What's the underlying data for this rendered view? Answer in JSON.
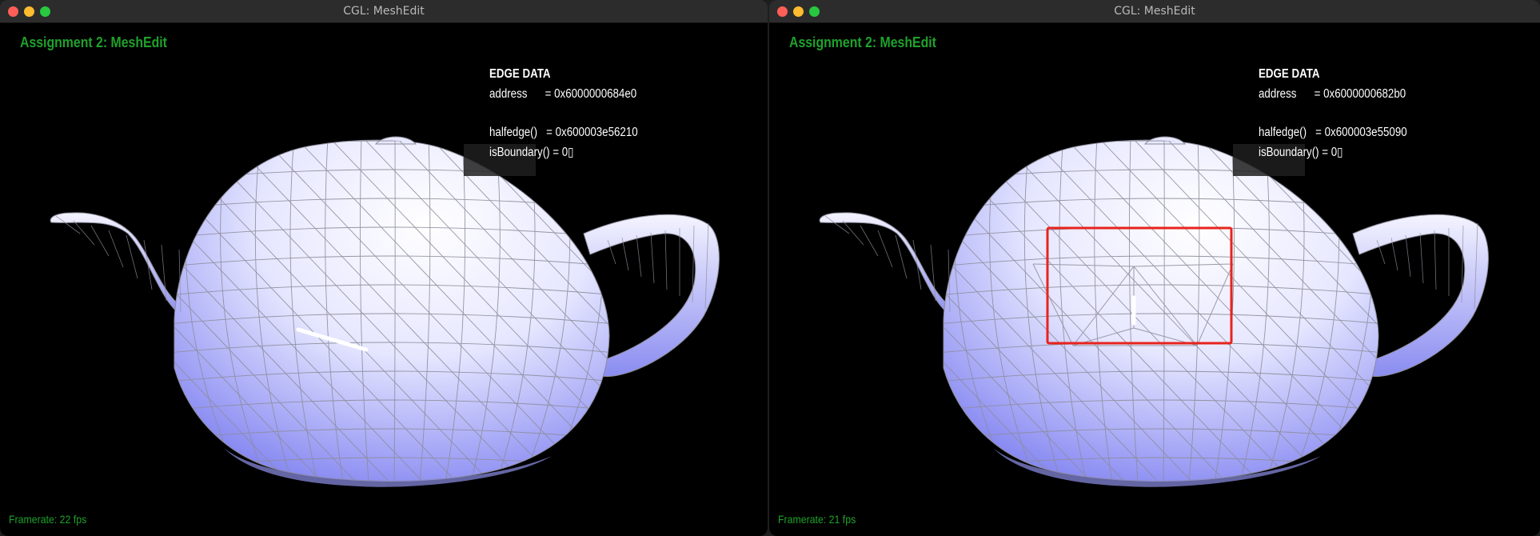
{
  "windows": [
    {
      "title": "CGL: MeshEdit",
      "assignment_label": "Assignment 2: MeshEdit",
      "edge_data": {
        "header": "EDGE DATA",
        "address_line": "address      = 0x6000000684e0",
        "halfedge_line": "halfedge()   = 0x600003e56210",
        "boundary_line": "isBoundary() = 0▯"
      },
      "framerate": "Framerate: 22 fps",
      "variant": "original"
    },
    {
      "title": "CGL: MeshEdit",
      "assignment_label": "Assignment 2: MeshEdit",
      "edge_data": {
        "header": "EDGE DATA",
        "address_line": "address      = 0x6000000682b0",
        "halfedge_line": "halfedge()   = 0x600003e55090",
        "boundary_line": "isBoundary() = 0▯"
      },
      "framerate": "Framerate: 21 fps",
      "variant": "flipped"
    }
  ],
  "colors": {
    "background": "#000000",
    "label_green": "#1fa12b",
    "mesh_light": "#ffffff",
    "mesh_shade": "#7b7df0",
    "wire": "#8c8c9a",
    "selected_edge": "#ffffff",
    "highlight_box": "#e8231e"
  }
}
